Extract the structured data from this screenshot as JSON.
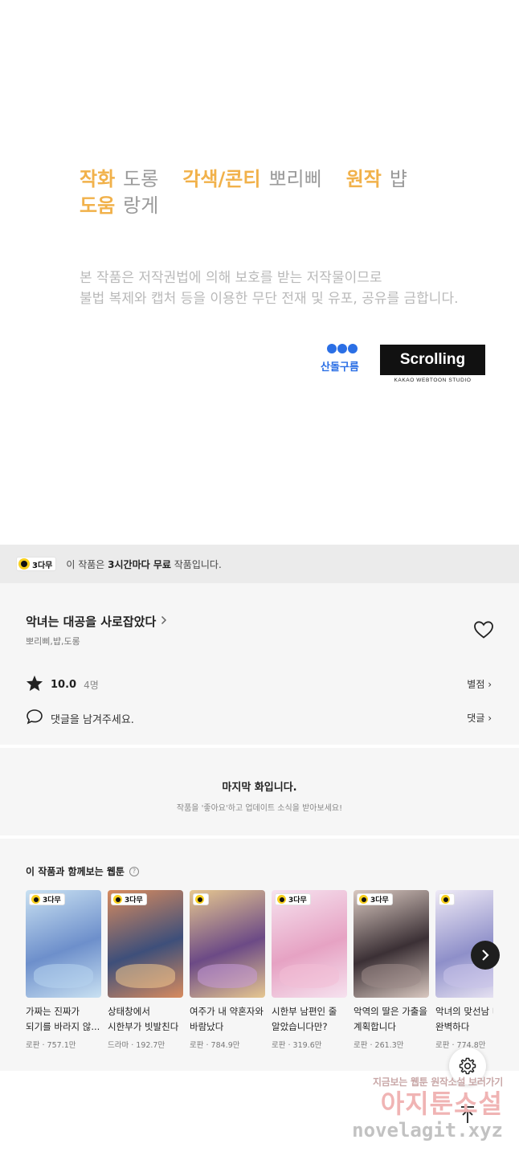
{
  "credits": {
    "art_role": "작화",
    "art_name": "도롱",
    "adapt_role": "각색/콘티",
    "adapt_name": "뽀리삐",
    "orig_role": "원작",
    "orig_name": "뱝",
    "assist_role": "도움",
    "assist_name": "랑게",
    "copyright_line1": "본 작품은 저작권법에 의해 보호를 받는 저작물이므로",
    "copyright_line2": "불법 복제와 캡처 등을 이용한 무단 전재 및 유포, 공유를 금합니다.",
    "logo_cloud": "산돌구름",
    "logo_scroll": "Scrolling",
    "logo_scroll_sub": "KAKAO WEBTOON STUDIO"
  },
  "free_banner": {
    "badge": "3다무",
    "text_pre": "이 작품은 ",
    "text_bold": "3시간마다 무료",
    "text_post": " 작품입니다."
  },
  "info": {
    "title": "악녀는 대공을 사로잡았다",
    "authors": "뽀리삐,뱝,도롱",
    "score": "10.0",
    "count": "4명",
    "rating_link": "별점 ›",
    "comment_prompt": "댓글을 남겨주세요.",
    "comment_link": "댓글 ›"
  },
  "last": {
    "title": "마지막 화입니다.",
    "sub": "작품을 '좋아요'하고 업데이트 소식을 받아보세요!"
  },
  "recs": {
    "title": "이 작품과 함께보는 웹툰",
    "badge": "3다무",
    "items": [
      {
        "title": "가짜는 진짜가 되기를 바라지 않...",
        "meta": "로판 · 757.1만",
        "color1": "#6d8fcb",
        "color2": "#c9e1f2",
        "accent": "#b6d4ee",
        "badge_label": "3다무"
      },
      {
        "title": "상태창에서 시한부가 빗발친다",
        "meta": "드라마 · 192.7만",
        "color1": "#3e4f7a",
        "color2": "#d88b5e",
        "accent": "#f2c98e",
        "badge_label": "3다무"
      },
      {
        "title": "여주가 내 약혼자와 바람났다",
        "meta": "로판 · 784.9만",
        "color1": "#6c4a86",
        "color2": "#e6c790",
        "accent": "#c79ad8",
        "badge_label": ""
      },
      {
        "title": "시한부 남편인 줄 알았습니다만?",
        "meta": "로판 · 319.6만",
        "color1": "#e6a2c3",
        "color2": "#f6e2ef",
        "accent": "#f3bdd6",
        "badge_label": "3다무"
      },
      {
        "title": "악역의 딸은 가출을 계획합니다",
        "meta": "로판 · 261.3만",
        "color1": "#3b3035",
        "color2": "#d9c8c0",
        "accent": "#9c8a88",
        "badge_label": "3다무"
      },
      {
        "title": "악녀의 맞선남 너무 완벽하다",
        "meta": "로판 · 774.8만",
        "color1": "#8e8fc9",
        "color2": "#efeaf6",
        "accent": "#c8c3ea",
        "badge_label": ""
      }
    ]
  },
  "watermark": {
    "top": "지금보는 웹툰 원작소설 보러가기",
    "mid": "아지툰소설",
    "bot": "novelagit.xyz"
  }
}
